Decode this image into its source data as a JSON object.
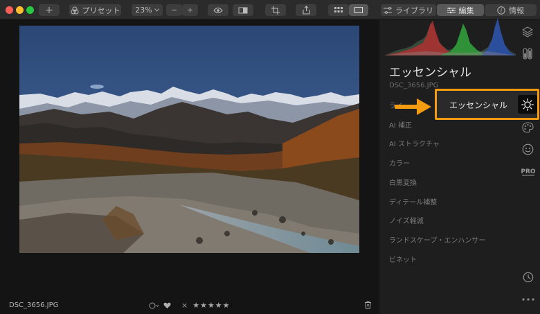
{
  "toolbar": {
    "preset_label": "プリセット",
    "zoom_value": "23%",
    "zoom_minus": "−",
    "zoom_plus": "+",
    "add_symbol": "+",
    "tabs": {
      "library": "ライブラリ",
      "edit": "編集",
      "info": "情報"
    }
  },
  "panel": {
    "title": "エッセンシャル",
    "file_name": "DSC_3656.JPG",
    "tools": [
      "エッセンシャル",
      "AI 補正",
      "AI ストラクチャ",
      "カラー",
      "白黒変換",
      "ディテール補整",
      "ノイズ軽減",
      "ランドスケープ・エンハンサー",
      "ビネット"
    ],
    "partial_first": "ライ"
  },
  "callout": {
    "label": "エッセンシャル",
    "accent_color": "#f39c12"
  },
  "status": {
    "file_name": "DSC_3656.JPG",
    "stars": "★★★★★",
    "reject": "×"
  },
  "icons": {
    "panel": [
      "layers-icon",
      "adjust-icon",
      "palette-icon",
      "face-icon",
      "pro-icon",
      "clock-icon",
      "more-icon"
    ],
    "pro_label": "PRO"
  }
}
